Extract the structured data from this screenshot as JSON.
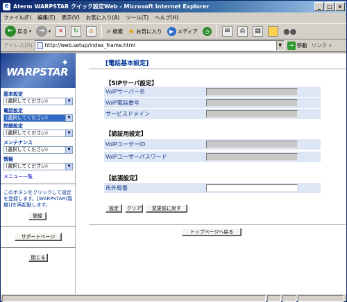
{
  "window": {
    "title": "Aterm WARPSTAR クイック設定Web - Microsoft Internet Explorer"
  },
  "menubar": [
    "ファイル(F)",
    "編集(E)",
    "表示(V)",
    "お気に入り(A)",
    "ツール(T)",
    "ヘルプ(H)"
  ],
  "toolbar": {
    "back": "戻る",
    "search": "検索",
    "favorites": "お気に入り",
    "media": "メディア"
  },
  "address": {
    "label": "アドレス(D)",
    "url": "http://web.setup/index_frame.html",
    "go": "移動",
    "links": "リンク"
  },
  "sidebar": {
    "logo": "WARPSTAR",
    "sections": [
      {
        "label": "基本設定",
        "value": "(選択してください)"
      },
      {
        "label": "電話設定",
        "value": "(選択してください)",
        "selected": true
      },
      {
        "label": "詳細設定",
        "value": "(選択してください)"
      },
      {
        "label": "メンテナンス",
        "value": "(選択してください)"
      },
      {
        "label": "情報",
        "value": "(選択してください)"
      }
    ],
    "menu_list": "メニュー一覧",
    "note": "このボタンをクリックして設定を登録します。[WARPSTAR(親機)]を再起動します。",
    "register": "登録",
    "support": "サポートページ",
    "close": "閉じる"
  },
  "main": {
    "title": "[電話基本設定]",
    "sip": {
      "header": "【SIPサーバ設定】",
      "rows": [
        "VoIPサーバー名",
        "VoIP電話番号",
        "サービスドメイン"
      ]
    },
    "auth": {
      "header": "【認証用設定】",
      "rows": [
        "VoIPユーザーID",
        "VoIPユーザーパスワード"
      ]
    },
    "ext": {
      "header": "【拡張設定】",
      "rows": [
        "市外局番"
      ]
    },
    "buttons": {
      "set": "設定",
      "clear": "クリア",
      "revert": "変更前に戻す"
    },
    "top": "トップページへ戻る"
  },
  "colors": {
    "title_bar": "#0a246a",
    "row_bg": "#dde6f4",
    "link": "#0000cc"
  }
}
